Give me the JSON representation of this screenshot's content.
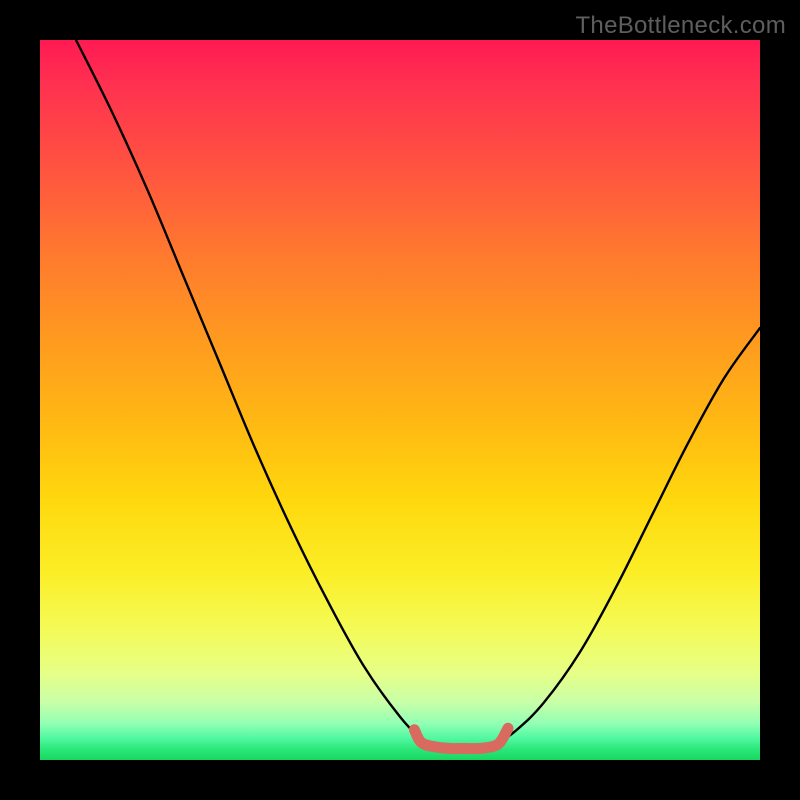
{
  "watermark": "TheBottleneck.com",
  "colors": {
    "background": "#000000",
    "curve": "#000000",
    "marker": "#d96a5f",
    "watermark": "#5e5e5e"
  },
  "chart_data": {
    "type": "line",
    "title": "",
    "xlabel": "",
    "ylabel": "",
    "xlim": [
      0,
      100
    ],
    "ylim": [
      0,
      100
    ],
    "grid": false,
    "legend": false,
    "series": [
      {
        "name": "left-curve",
        "x": [
          5,
          10,
          15,
          20,
          25,
          30,
          35,
          40,
          45,
          50,
          53,
          55
        ],
        "y": [
          100,
          90,
          79,
          67,
          55,
          43,
          32,
          22,
          13,
          6,
          3,
          2
        ]
      },
      {
        "name": "right-curve",
        "x": [
          63,
          66,
          70,
          75,
          80,
          85,
          90,
          95,
          100
        ],
        "y": [
          2,
          4,
          8,
          15,
          24,
          34,
          44,
          53,
          60
        ]
      },
      {
        "name": "valley-marker",
        "x": [
          52,
          53,
          55,
          57,
          59,
          61,
          63,
          64,
          65
        ],
        "y": [
          4.2,
          2.4,
          1.8,
          1.6,
          1.6,
          1.6,
          1.9,
          2.6,
          4.4
        ]
      }
    ],
    "annotations": [
      {
        "text": "TheBottleneck.com",
        "position": "top-right"
      }
    ]
  }
}
